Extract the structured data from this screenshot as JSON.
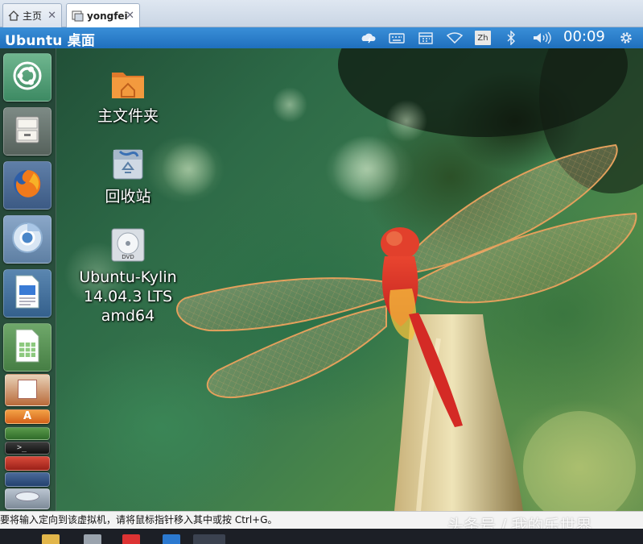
{
  "tabs": [
    {
      "label": "主页",
      "icon": "home-icon",
      "active": false
    },
    {
      "label": "yongfei",
      "icon": "vm-icon",
      "active": true
    }
  ],
  "panel": {
    "title": "Ubuntu 桌面",
    "input_method": "Zh",
    "clock": "00:09"
  },
  "desktop_icons": [
    {
      "lines": [
        "主文件夹"
      ],
      "icon": "home-folder-icon"
    },
    {
      "lines": [
        "回收站"
      ],
      "icon": "trash-icon"
    },
    {
      "lines": [
        "Ubuntu-Kylin",
        "14.04.3 LTS",
        "amd64"
      ],
      "icon": "dvd-icon"
    }
  ],
  "launcher": [
    {
      "name": "dash-home",
      "icon": "ubuntu-logo-icon"
    },
    {
      "name": "files",
      "icon": "file-cabinet-icon"
    },
    {
      "name": "firefox",
      "icon": "firefox-icon"
    },
    {
      "name": "chromium",
      "icon": "chromium-icon"
    },
    {
      "name": "libreoffice-writer",
      "icon": "writer-document-icon"
    },
    {
      "name": "libreoffice-calc",
      "icon": "calc-spreadsheet-icon"
    },
    {
      "name": "libreoffice-impress",
      "icon": "impress-icon"
    },
    {
      "name": "software-center",
      "icon": "software-center-icon"
    },
    {
      "name": "terminal",
      "icon": "terminal-icon"
    },
    {
      "name": "app-stack-1",
      "icon": "app-icon"
    },
    {
      "name": "app-stack-2",
      "icon": "app-icon"
    },
    {
      "name": "dvd-stack",
      "icon": "dvd-icon"
    }
  ],
  "statusbar": {
    "message": "要将输入定向到该虚拟机，请将鼠标指针移入其中或按 Ctrl+G。"
  },
  "watermark": "头条号 / 我的乐世界",
  "colors": {
    "panel_blue": "#2b7fd0",
    "tab_bg": "#d9e2ee",
    "dragonfly_red": "#d8302a"
  }
}
